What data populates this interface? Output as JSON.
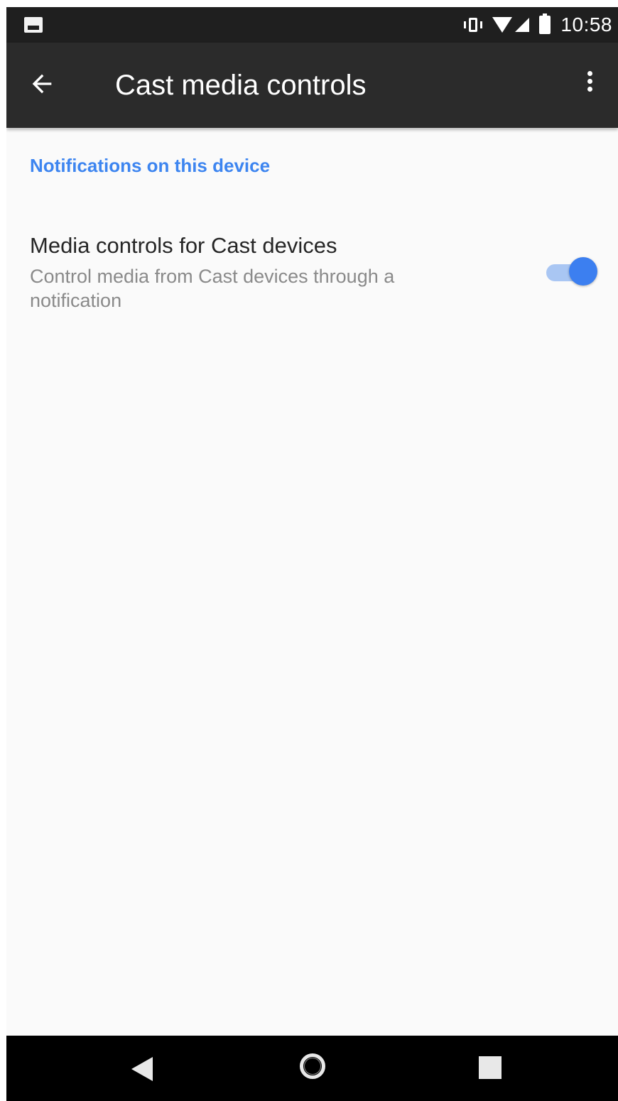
{
  "status_bar": {
    "time": "10:58",
    "icons": [
      "photo-icon",
      "vibrate-icon",
      "wifi-icon",
      "signal-icon",
      "battery-icon"
    ]
  },
  "toolbar": {
    "title": "Cast media controls",
    "back_icon": "arrow-back-icon",
    "overflow_icon": "more-vert-icon"
  },
  "content": {
    "section_header": "Notifications on this device",
    "preference": {
      "title": "Media controls for Cast devices",
      "summary": "Control media from Cast devices through a notification",
      "toggle_state": "on"
    }
  },
  "colors": {
    "accent": "#3d85f0",
    "toolbar_bg": "#2b2b2b",
    "status_bar_bg": "#1f1f1f",
    "page_bg": "#fafafa"
  },
  "nav_bar": {
    "icons": [
      "nav-back-icon",
      "nav-home-icon",
      "nav-recents-icon"
    ]
  }
}
